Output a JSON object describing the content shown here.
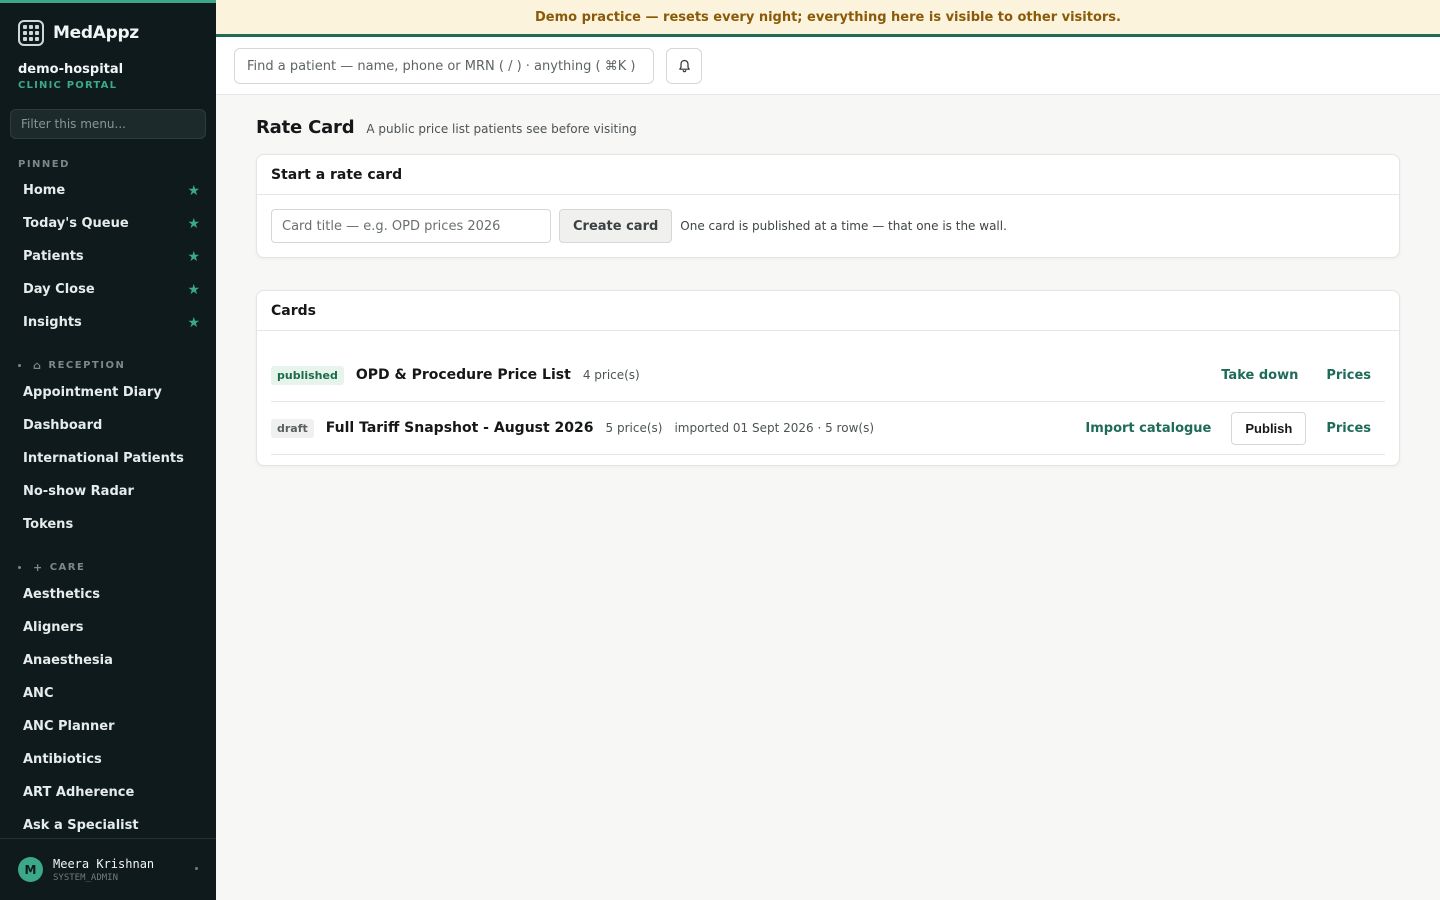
{
  "banner": {
    "text": "Demo practice — resets every night; everything here is visible to other visitors."
  },
  "sidebar": {
    "brand": "MedAppz",
    "org_name": "demo-hospital",
    "org_sub": "CLINIC PORTAL",
    "filter_placeholder": "Filter this menu...",
    "pinned_label": "PINNED",
    "pinned": [
      {
        "label": "Home"
      },
      {
        "label": "Today's Queue"
      },
      {
        "label": "Patients"
      },
      {
        "label": "Day Close"
      },
      {
        "label": "Insights"
      }
    ],
    "reception_label": "RECEPTION",
    "reception": [
      {
        "label": "Appointment Diary"
      },
      {
        "label": "Dashboard"
      },
      {
        "label": "International Patients"
      },
      {
        "label": "No-show Radar"
      },
      {
        "label": "Tokens"
      }
    ],
    "care_label": "CARE",
    "care": [
      {
        "label": "Aesthetics"
      },
      {
        "label": "Aligners"
      },
      {
        "label": "Anaesthesia"
      },
      {
        "label": "ANC"
      },
      {
        "label": "ANC Planner"
      },
      {
        "label": "Antibiotics"
      },
      {
        "label": "ART Adherence"
      },
      {
        "label": "Ask a Specialist"
      }
    ],
    "user": {
      "initial": "M",
      "name": "Meera Krishnan",
      "role": "SYSTEM_ADMIN"
    }
  },
  "topbar": {
    "search_placeholder": "Find a patient — name, phone or MRN ( / ) · anything ( ⌘K )"
  },
  "page": {
    "title": "Rate Card",
    "subtitle": "A public price list patients see before visiting"
  },
  "start_card": {
    "title": "Start a rate card",
    "input_placeholder": "Card title — e.g. OPD prices 2026",
    "create_label": "Create card",
    "hint": "One card is published at a time — that one is the wall."
  },
  "cards": {
    "title": "Cards",
    "rows": [
      {
        "status": "published",
        "title": "OPD & Procedure Price List",
        "prices": "4 price(s)",
        "action": "Take down",
        "prices_link": "Prices"
      },
      {
        "status": "draft",
        "title": "Full Tariff Snapshot - August 2026",
        "prices": "5 price(s)",
        "imported": "imported 01 Sept 2026 · 5 row(s)",
        "import_label": "Import catalogue",
        "publish_label": "Publish",
        "prices_link": "Prices"
      }
    ]
  },
  "colors": {
    "accent": "#3ba888",
    "link": "#1f6b58",
    "sidebar_bg": "#0f1a1c",
    "banner_bg": "#fbf3dc",
    "banner_text": "#8a5a08"
  }
}
